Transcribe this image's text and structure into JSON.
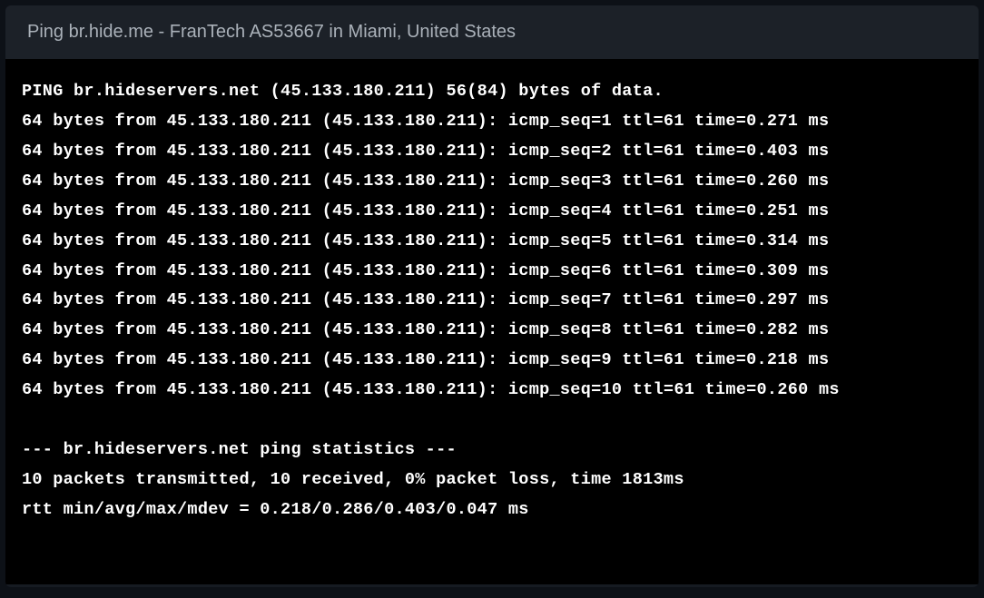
{
  "header": {
    "title": "Ping br.hide.me - FranTech AS53667 in Miami, United States"
  },
  "ping": {
    "header_line": "PING br.hideservers.net (45.133.180.211) 56(84) bytes of data.",
    "host": "br.hideservers.net",
    "ip": "45.133.180.211",
    "bytes": "56(84)",
    "replies": [
      {
        "bytes": 64,
        "from_ip": "45.133.180.211",
        "from_paren": "45.133.180.211",
        "icmp_seq": 1,
        "ttl": 61,
        "time": "0.271",
        "unit": "ms"
      },
      {
        "bytes": 64,
        "from_ip": "45.133.180.211",
        "from_paren": "45.133.180.211",
        "icmp_seq": 2,
        "ttl": 61,
        "time": "0.403",
        "unit": "ms"
      },
      {
        "bytes": 64,
        "from_ip": "45.133.180.211",
        "from_paren": "45.133.180.211",
        "icmp_seq": 3,
        "ttl": 61,
        "time": "0.260",
        "unit": "ms"
      },
      {
        "bytes": 64,
        "from_ip": "45.133.180.211",
        "from_paren": "45.133.180.211",
        "icmp_seq": 4,
        "ttl": 61,
        "time": "0.251",
        "unit": "ms"
      },
      {
        "bytes": 64,
        "from_ip": "45.133.180.211",
        "from_paren": "45.133.180.211",
        "icmp_seq": 5,
        "ttl": 61,
        "time": "0.314",
        "unit": "ms"
      },
      {
        "bytes": 64,
        "from_ip": "45.133.180.211",
        "from_paren": "45.133.180.211",
        "icmp_seq": 6,
        "ttl": 61,
        "time": "0.309",
        "unit": "ms"
      },
      {
        "bytes": 64,
        "from_ip": "45.133.180.211",
        "from_paren": "45.133.180.211",
        "icmp_seq": 7,
        "ttl": 61,
        "time": "0.297",
        "unit": "ms"
      },
      {
        "bytes": 64,
        "from_ip": "45.133.180.211",
        "from_paren": "45.133.180.211",
        "icmp_seq": 8,
        "ttl": 61,
        "time": "0.282",
        "unit": "ms"
      },
      {
        "bytes": 64,
        "from_ip": "45.133.180.211",
        "from_paren": "45.133.180.211",
        "icmp_seq": 9,
        "ttl": 61,
        "time": "0.218",
        "unit": "ms"
      },
      {
        "bytes": 64,
        "from_ip": "45.133.180.211",
        "from_paren": "45.133.180.211",
        "icmp_seq": 10,
        "ttl": 61,
        "time": "0.260",
        "unit": "ms"
      }
    ],
    "stats_header": "--- br.hideservers.net ping statistics ---",
    "stats_summary": "10 packets transmitted, 10 received, 0% packet loss, time 1813ms",
    "stats_rtt": "rtt min/avg/max/mdev = 0.218/0.286/0.403/0.047 ms",
    "stats": {
      "transmitted": 10,
      "received": 10,
      "loss_pct": "0%",
      "time_ms": 1813,
      "rtt_min": "0.218",
      "rtt_avg": "0.286",
      "rtt_max": "0.403",
      "rtt_mdev": "0.047",
      "rtt_unit": "ms"
    }
  }
}
